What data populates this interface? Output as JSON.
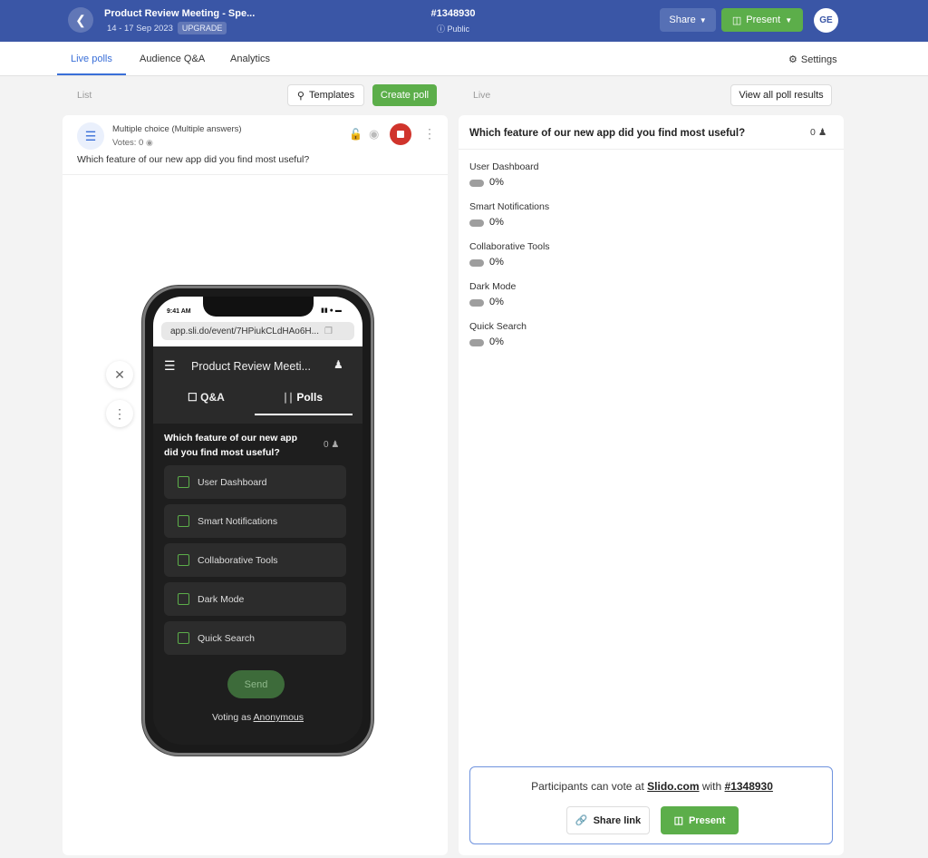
{
  "header": {
    "event_title": "Product Review Meeting - Spe...",
    "event_dates": "14 - 17 Sep 2023",
    "upgrade_badge": "UPGRADE",
    "event_code": "#1348930",
    "visibility": "Public",
    "share_label": "Share",
    "present_label": "Present",
    "avatar_initials": "GE",
    "colors": {
      "brand": "#3a56a6",
      "accent_green": "#5cae4a"
    }
  },
  "tabs": [
    {
      "label": "Live polls",
      "active": true
    },
    {
      "label": "Audience Q&A",
      "active": false
    },
    {
      "label": "Analytics",
      "active": false
    }
  ],
  "settings_label": "Settings",
  "list_panel": {
    "section_label": "List",
    "templates_label": "Templates",
    "create_poll_label": "Create poll",
    "poll": {
      "type": "Multiple choice (Multiple answers)",
      "votes": "Votes: 0",
      "question": "Which feature of our new app did you find most useful?"
    }
  },
  "phone_preview": {
    "time": "9:41 AM",
    "url": "app.sli.do/event/7HPiukCLdHAo6H...",
    "app_title": "Product Review Meeti...",
    "tab_qa": "Q&A",
    "tab_polls": "Polls",
    "question": "Which feature of our new app did you find most useful?",
    "participants": "0",
    "options": [
      "User Dashboard",
      "Smart Notifications",
      "Collaborative Tools",
      "Dark Mode",
      "Quick Search"
    ],
    "send_label": "Send",
    "voting_as_prefix": "Voting as ",
    "voting_as_name": "Anonymous"
  },
  "live_panel": {
    "section_label": "Live",
    "view_all_label": "View all poll results",
    "question": "Which feature of our new app did you find most useful?",
    "participants": "0",
    "results": [
      {
        "label": "User Dashboard",
        "percent": "0%"
      },
      {
        "label": "Smart Notifications",
        "percent": "0%"
      },
      {
        "label": "Collaborative Tools",
        "percent": "0%"
      },
      {
        "label": "Dark Mode",
        "percent": "0%"
      },
      {
        "label": "Quick Search",
        "percent": "0%"
      }
    ],
    "info_prefix": "Participants can vote at ",
    "info_site": "Slido.com",
    "info_mid": " with ",
    "info_code": "#1348930",
    "share_link_label": "Share link",
    "present_label": "Present"
  }
}
